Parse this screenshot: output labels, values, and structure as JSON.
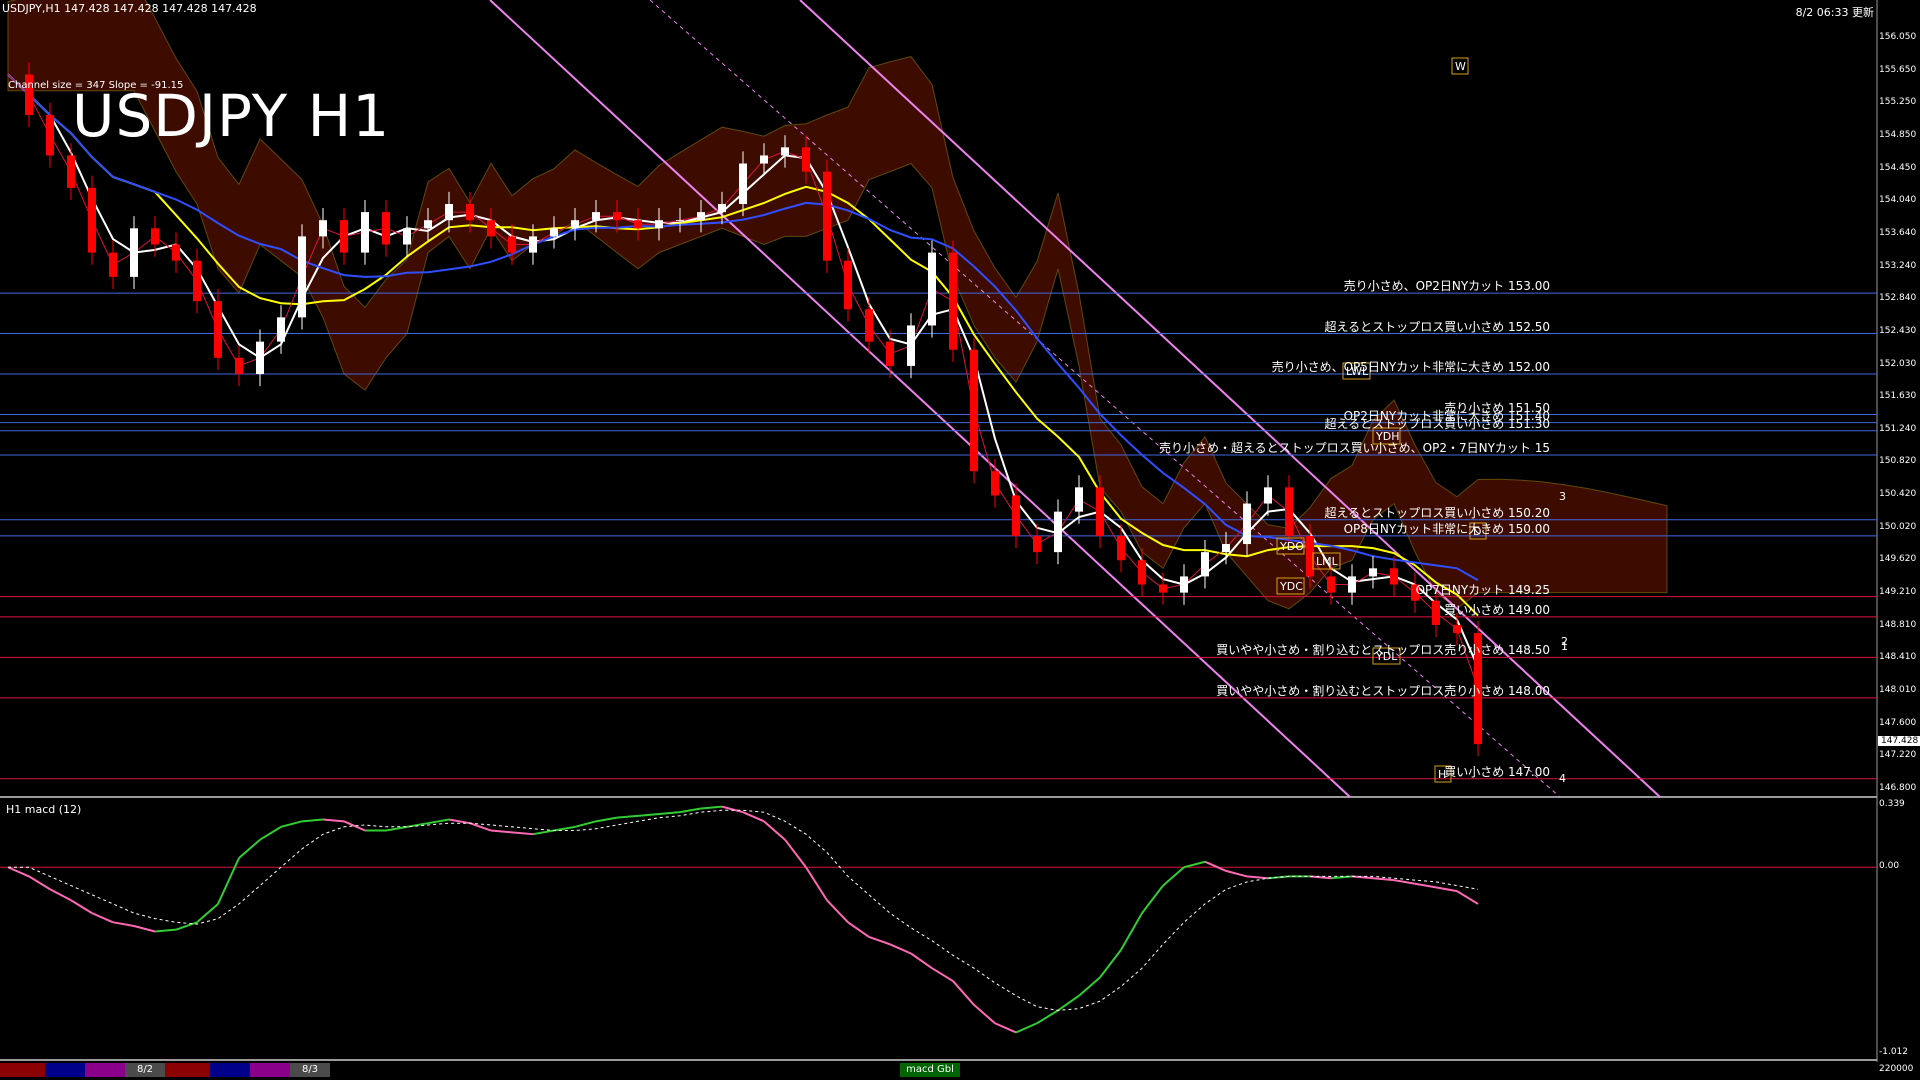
{
  "header": {
    "symbol": "USDJPY,H1",
    "ohlc": "147.428 147.428 147.428 147.428",
    "datetime": "8/2 06:33 更新",
    "channel_info": "Channel size = 347  Slope = -91.15",
    "big_title": "USDJPY H1"
  },
  "macd_panel": {
    "label": "H1  macd (12)"
  },
  "bottom_bar": {
    "labels": [
      "8/2",
      "8/3",
      "macd Gbl"
    ],
    "colors": [
      "#8b0000",
      "#00008b",
      "#8b008b",
      "#4b4b4b",
      "#8b0000",
      "#00008b",
      "#8b008b",
      "#4b4b4b",
      "#006400"
    ]
  },
  "current_price": "147.428",
  "chart_data": {
    "type": "line",
    "title": "USDJPY H1",
    "xlabel": "",
    "ylabel": "",
    "ylim": [
      146.8,
      156.2
    ],
    "price_ticks": [
      "156.050",
      "155.650",
      "155.250",
      "154.850",
      "154.450",
      "154.040",
      "153.640",
      "153.240",
      "152.840",
      "152.430",
      "152.030",
      "151.630",
      "151.240",
      "150.820",
      "150.420",
      "150.020",
      "149.620",
      "149.210",
      "148.810",
      "148.410",
      "148.010",
      "147.600",
      "147.220",
      "146.800"
    ],
    "macd_ticks": [
      "0.339",
      "0.00",
      "-1.012"
    ],
    "macd_ylim": [
      -1.012,
      0.339
    ],
    "bottom_right_value": "220000",
    "levels": [
      {
        "price": 153.0,
        "text": "売り小さめ、OP2日NYカット 153.00",
        "color": "#4169e1"
      },
      {
        "price": 152.5,
        "text": "超えるとストップロス買い小さめ 152.50",
        "color": "#4169e1"
      },
      {
        "price": 152.0,
        "text": "売り小さめ、OP5日NYカット非常に大きめ 152.00",
        "color": "#4169e1"
      },
      {
        "price": 151.5,
        "text": "売り小さめ 151.50",
        "color": "#4169e1"
      },
      {
        "price": 151.4,
        "text": "OP2日NYカット非常に大きめ 151.40",
        "color": "#4169e1"
      },
      {
        "price": 151.3,
        "text": "超えるとストップロス買い小さめ 151.30",
        "color": "#4169e1"
      },
      {
        "price": 151.0,
        "text": "売り小さめ・超えるとストップロス買い小さめ、OP2・7日NYカット 15",
        "color": "#4169e1"
      },
      {
        "price": 150.2,
        "text": "超えるとストップロス買い小さめ 150.20",
        "color": "#4169e1"
      },
      {
        "price": 150.0,
        "text": "OP8日NYカット非常に大きめ 150.00",
        "color": "#4169e1"
      },
      {
        "price": 149.25,
        "text": "OP7日NYカット 149.25",
        "color": "#dc143c"
      },
      {
        "price": 149.0,
        "text": "買い小さめ 149.00",
        "color": "#dc143c"
      },
      {
        "price": 148.5,
        "text": "買いやや小さめ・割り込むとストップロス売り小さめ 148.50",
        "color": "#dc143c"
      },
      {
        "price": 148.0,
        "text": "買いやや小さめ・割り込むとストップロス売り小さめ 148.00",
        "color": "#dc143c"
      },
      {
        "price": 147.0,
        "text": "買い小さめ 147.00",
        "color": "#dc143c"
      }
    ],
    "markers": [
      "YDO",
      "YDC",
      "YDH",
      "YDL",
      "LML",
      "LWL",
      "W",
      "D",
      "H",
      "1",
      "2",
      "3",
      "4"
    ],
    "series": [
      {
        "name": "close",
        "values": [
          155.7,
          155.2,
          154.7,
          154.3,
          153.5,
          153.2,
          153.8,
          153.6,
          153.4,
          152.9,
          152.2,
          152.0,
          152.4,
          152.7,
          153.7,
          153.9,
          153.5,
          154.0,
          153.6,
          153.8,
          153.9,
          154.1,
          153.9,
          153.7,
          153.5,
          153.7,
          153.8,
          153.9,
          154.0,
          153.9,
          153.8,
          153.9,
          153.9,
          154.0,
          154.1,
          154.6,
          154.7,
          154.8,
          154.5,
          153.4,
          152.8,
          152.4,
          152.1,
          152.6,
          153.5,
          152.3,
          150.8,
          150.5,
          150.0,
          149.8,
          150.3,
          150.6,
          150.0,
          149.7,
          149.4,
          149.3,
          149.5,
          149.8,
          149.9,
          150.4,
          150.6,
          150.0,
          149.5,
          149.3,
          149.5,
          149.6,
          149.4,
          149.2,
          148.9,
          148.8,
          147.428
        ]
      },
      {
        "name": "macd",
        "values": [
          0.0,
          -0.05,
          -0.12,
          -0.18,
          -0.25,
          -0.3,
          -0.32,
          -0.35,
          -0.34,
          -0.3,
          -0.2,
          0.05,
          0.15,
          0.22,
          0.25,
          0.26,
          0.25,
          0.2,
          0.2,
          0.22,
          0.24,
          0.26,
          0.24,
          0.2,
          0.19,
          0.18,
          0.2,
          0.22,
          0.25,
          0.27,
          0.28,
          0.29,
          0.3,
          0.32,
          0.33,
          0.3,
          0.25,
          0.15,
          0.0,
          -0.18,
          -0.3,
          -0.38,
          -0.42,
          -0.47,
          -0.55,
          -0.62,
          -0.75,
          -0.85,
          -0.9,
          -0.85,
          -0.78,
          -0.7,
          -0.6,
          -0.45,
          -0.25,
          -0.1,
          0.0,
          0.03,
          -0.02,
          -0.05,
          -0.06,
          -0.05,
          -0.05,
          -0.06,
          -0.05,
          -0.06,
          -0.07,
          -0.09,
          -0.11,
          -0.13,
          -0.2
        ]
      },
      {
        "name": "signal",
        "values": [
          0.0,
          0.0,
          -0.05,
          -0.1,
          -0.15,
          -0.2,
          -0.25,
          -0.28,
          -0.3,
          -0.31,
          -0.28,
          -0.2,
          -0.1,
          0.0,
          0.1,
          0.18,
          0.22,
          0.23,
          0.22,
          0.22,
          0.23,
          0.24,
          0.24,
          0.23,
          0.22,
          0.21,
          0.2,
          0.2,
          0.21,
          0.23,
          0.25,
          0.27,
          0.28,
          0.3,
          0.31,
          0.31,
          0.3,
          0.25,
          0.18,
          0.08,
          -0.05,
          -0.15,
          -0.25,
          -0.33,
          -0.4,
          -0.48,
          -0.55,
          -0.63,
          -0.7,
          -0.76,
          -0.78,
          -0.77,
          -0.73,
          -0.65,
          -0.55,
          -0.42,
          -0.3,
          -0.2,
          -0.12,
          -0.08,
          -0.06,
          -0.05,
          -0.05,
          -0.05,
          -0.05,
          -0.05,
          -0.06,
          -0.07,
          -0.08,
          -0.1,
          -0.12
        ]
      }
    ]
  }
}
